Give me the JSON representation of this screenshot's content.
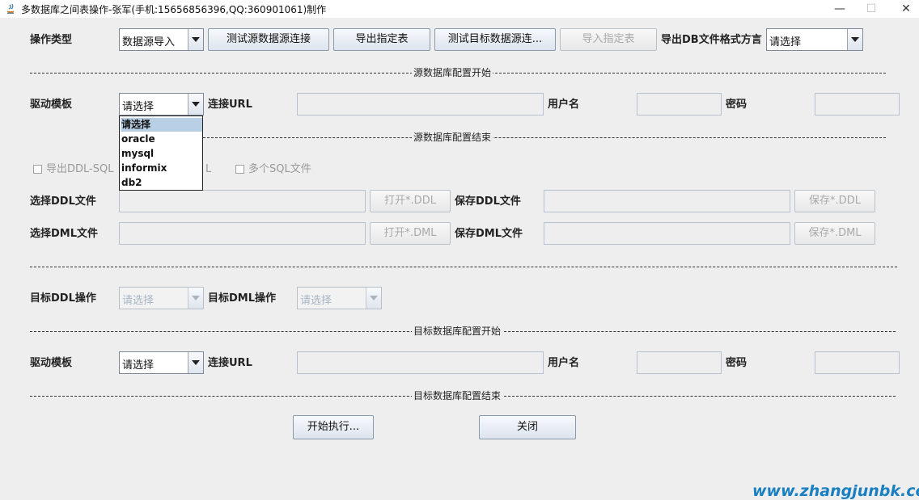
{
  "window": {
    "title": "多数据库之间表操作-张军(手机:15656856396,QQ:360901061)制作",
    "minimize": "—",
    "maximize": "☐",
    "close": "✕"
  },
  "top": {
    "op_type_label": "操作类型",
    "op_type_value": "数据源导入",
    "btn_test_source": "测试源数据源连接",
    "btn_export_table": "导出指定表",
    "btn_test_target": "测试目标数据源连...",
    "btn_import_table": "导入指定表",
    "dialect_label": "导出DB文件格式方言",
    "dialect_value": "请选择"
  },
  "source": {
    "start_label": "源数据库配置开始",
    "end_label": "源数据库配置结束",
    "driver_label": "驱动模板",
    "driver_value": "请选择",
    "url_label": "连接URL",
    "user_label": "用户名",
    "password_label": "密码",
    "dropdown_options": [
      "请选择",
      "oracle",
      "mysql",
      "informix",
      "db2"
    ]
  },
  "files": {
    "export_ddl_sql": "导出DDL-SQL",
    "export_dml_partial": "L",
    "multi_sql": "多个SQL文件",
    "select_ddl": "选择DDL文件",
    "open_ddl": "打开*.DDL",
    "save_ddl_label": "保存DDL文件",
    "save_ddl_btn": "保存*.DDL",
    "select_dml": "选择DML文件",
    "open_dml": "打开*.DML",
    "save_dml_label": "保存DML文件",
    "save_dml_btn": "保存*.DML"
  },
  "target_ops": {
    "ddl_label": "目标DDL操作",
    "ddl_value": "请选择",
    "dml_label": "目标DML操作",
    "dml_value": "请选择"
  },
  "target": {
    "start_label": "目标数据库配置开始",
    "end_label": "目标数据库配置结束",
    "driver_label": "驱动模板",
    "driver_value": "请选择",
    "url_label": "连接URL",
    "user_label": "用户名",
    "password_label": "密码"
  },
  "actions": {
    "start": "开始执行...",
    "close": "关闭"
  },
  "watermark": "www.zhangjunbk.com"
}
